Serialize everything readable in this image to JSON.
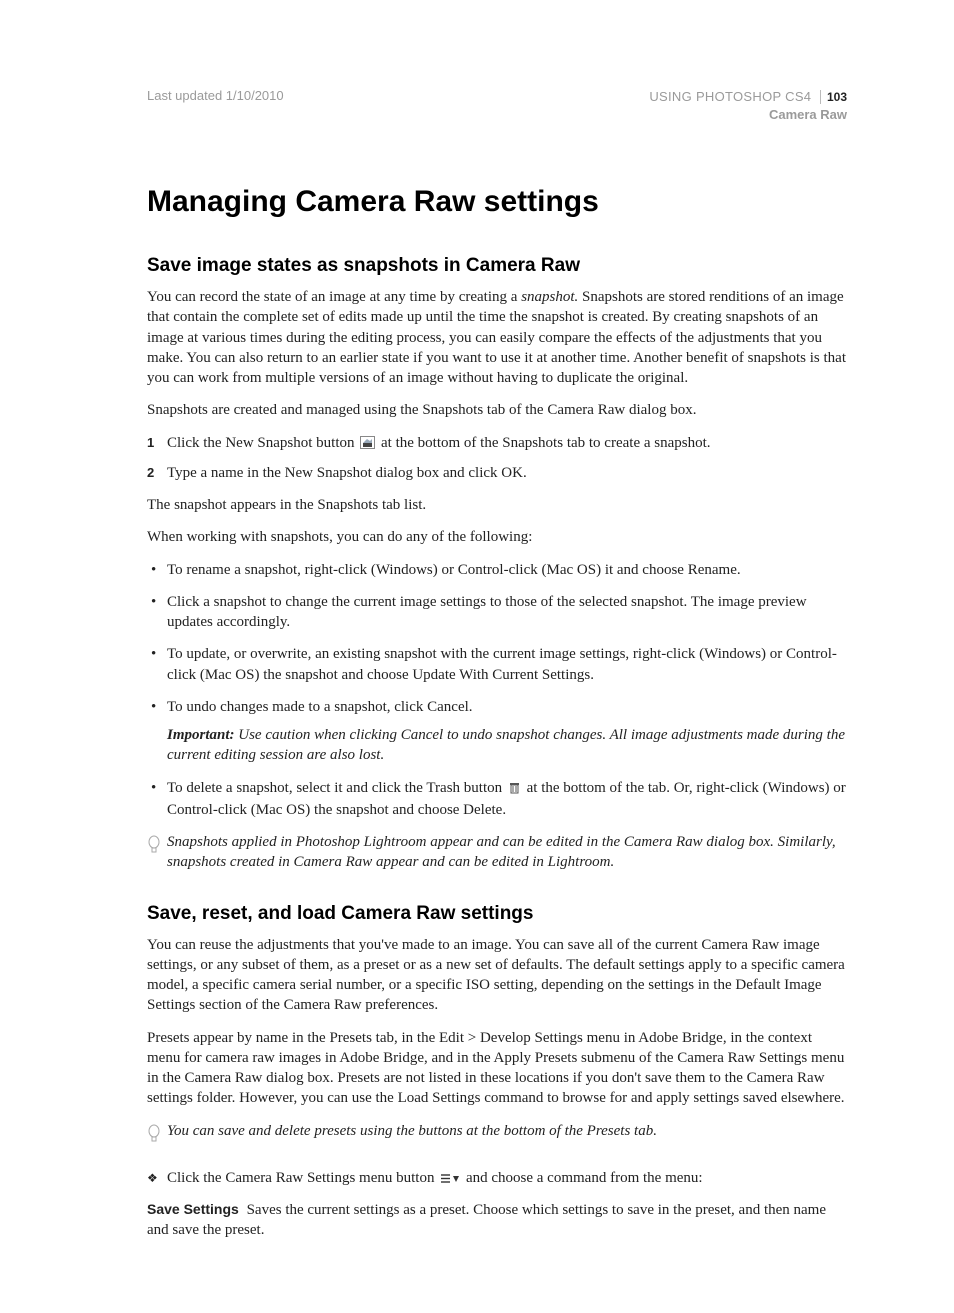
{
  "header": {
    "last_updated": "Last updated 1/10/2010",
    "doc_title": "USING PHOTOSHOP CS4",
    "section": "Camera Raw",
    "page_number": "103"
  },
  "h1": "Managing Camera Raw settings",
  "sec1": {
    "title": "Save image states as snapshots in Camera Raw",
    "p1a": "You can record the state of an image at any time by creating a ",
    "p1b": "snapshot.",
    "p1c": " Snapshots are stored renditions of an image that contain the complete set of edits made up until the time the snapshot is created. By creating snapshots of an image at various times during the editing process, you can easily compare the effects of the adjustments that you make. You can also return to an earlier state if you want to use it at another time. Another benefit of snapshots is that you can work from multiple versions of an image without having to duplicate the original.",
    "p2": "Snapshots are created and managed using the Snapshots tab of the Camera Raw dialog box.",
    "steps": [
      {
        "n": "1",
        "pre": "Click the New Snapshot button ",
        "post": " at the bottom of the Snapshots tab to create a snapshot."
      },
      {
        "n": "2",
        "text": "Type a name in the New Snapshot dialog box and click OK."
      }
    ],
    "p3": "The snapshot appears in the Snapshots tab list.",
    "p4": "When working with snapshots, you can do any of the following:",
    "bullets": [
      {
        "text": "To rename a snapshot, right-click (Windows) or Control-click (Mac OS) it and choose Rename."
      },
      {
        "text": "Click a snapshot to change the current image settings to those of the selected snapshot. The image preview updates accordingly."
      },
      {
        "text": "To update, or overwrite, an existing snapshot with the current image settings, right-click (Windows) or Control-click (Mac OS) the snapshot and choose Update With Current Settings."
      },
      {
        "text": "To undo changes made to a snapshot, click Cancel.",
        "note_label": "Important:",
        "note": " Use caution when clicking Cancel to undo snapshot changes. All image adjustments made during the current editing session are also lost."
      },
      {
        "pre": "To delete a snapshot, select it and click the Trash button ",
        "post": " at the bottom of the tab. Or, right-click (Windows) or Control-click (Mac OS) the snapshot and choose Delete."
      }
    ],
    "tip": "Snapshots applied in Photoshop Lightroom appear and can be edited in the Camera Raw dialog box. Similarly, snapshots created in Camera Raw appear and can be edited in Lightroom."
  },
  "sec2": {
    "title": "Save, reset, and load Camera Raw settings",
    "p1": "You can reuse the adjustments that you've made to an image. You can save all of the current Camera Raw image settings, or any subset of them, as a preset or as a new set of defaults. The default settings apply to a specific camera model, a specific camera serial number, or a specific ISO setting, depending on the settings in the Default Image Settings section of the Camera Raw preferences.",
    "p2": "Presets appear by name in the Presets tab, in the Edit > Develop Settings menu in Adobe Bridge, in the context menu for camera raw images in Adobe Bridge, and in the Apply Presets submenu of the Camera Raw Settings menu in the Camera Raw dialog box. Presets are not listed in these locations if you don't save them to the Camera Raw settings folder. However, you can use the Load Settings command to browse for and apply settings saved elsewhere.",
    "tip": "You can save and delete presets using the buttons at the bottom of the Presets tab.",
    "diamond_pre": "Click the Camera Raw Settings menu button ",
    "diamond_post": " and choose a command from the menu:",
    "def_term": "Save Settings",
    "def_body": "Saves the current settings as a preset. Choose which settings to save in the preset, and then name and save the preset."
  },
  "icons": {
    "new_snapshot": "new-snapshot-icon",
    "trash": "trash-icon",
    "settings_menu": "settings-menu-icon",
    "bulb": "tip-bulb-icon",
    "diamond": "❖"
  }
}
